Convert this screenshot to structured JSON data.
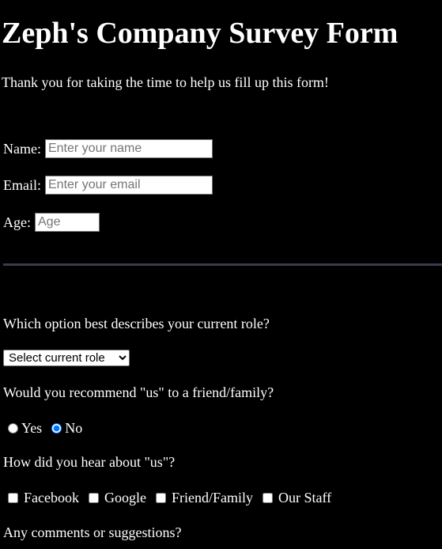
{
  "header": {
    "title": "Zeph's Company Survey Form",
    "intro": "Thank you for taking the time to help us fill up this form!"
  },
  "fields": {
    "name": {
      "label": "Name:",
      "placeholder": "Enter your name",
      "value": ""
    },
    "email": {
      "label": "Email:",
      "placeholder": "Enter your email",
      "value": ""
    },
    "age": {
      "label": "Age:",
      "placeholder": "Age",
      "value": ""
    }
  },
  "role": {
    "question": "Which option best describes your current role?",
    "selected": "Select current role"
  },
  "recommend": {
    "question": "Would you recommend \"us\" to a friend/family?",
    "options": [
      {
        "label": "Yes",
        "checked": false
      },
      {
        "label": "No",
        "checked": true
      }
    ]
  },
  "source": {
    "question": "How did you hear about \"us\"?",
    "options": [
      {
        "label": "Facebook",
        "checked": false
      },
      {
        "label": "Google",
        "checked": false
      },
      {
        "label": "Friend/Family",
        "checked": false
      },
      {
        "label": "Our Staff",
        "checked": false
      }
    ]
  },
  "comments": {
    "question": "Any comments or suggestions?"
  },
  "colors": {
    "background": "#000000",
    "text": "#ffffff",
    "divider": "#3a3a4e"
  }
}
